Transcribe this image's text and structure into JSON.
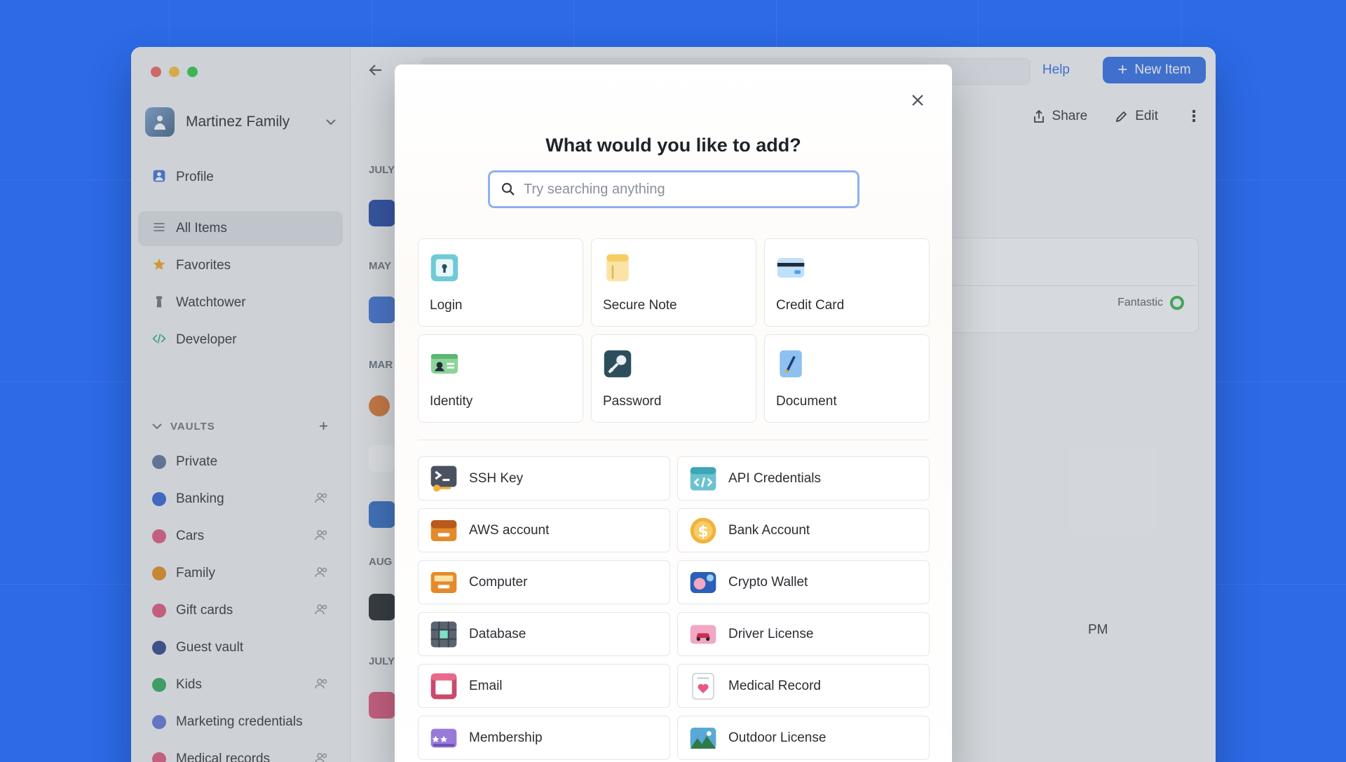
{
  "account": {
    "name": "Martinez Family"
  },
  "nav": [
    {
      "name": "nav-profile",
      "label": "Profile",
      "icon": "person-icon",
      "color": "#3a70d8",
      "active": false
    },
    {
      "name": "nav-all-items",
      "label": "All Items",
      "icon": "list-icon",
      "color": "#7a8088",
      "active": true
    },
    {
      "name": "nav-favorites",
      "label": "Favorites",
      "icon": "star-icon",
      "color": "#f2a413",
      "active": false
    },
    {
      "name": "nav-watchtower",
      "label": "Watchtower",
      "icon": "tower-icon",
      "color": "#6a6f77",
      "active": false
    },
    {
      "name": "nav-developer",
      "label": "Developer",
      "icon": "code-icon",
      "color": "#2aa87a",
      "active": false
    }
  ],
  "vaults": {
    "header": "VAULTS",
    "items": [
      {
        "label": "Private",
        "icon": "gear-icon",
        "color": "#5a6e9a",
        "shared": false
      },
      {
        "label": "Banking",
        "icon": "banking-icon",
        "color": "#2c5fd1",
        "shared": true
      },
      {
        "label": "Cars",
        "icon": "car-icon",
        "color": "#e0527a",
        "shared": true
      },
      {
        "label": "Family",
        "icon": "family-icon",
        "color": "#e28a15",
        "shared": true
      },
      {
        "label": "Gift cards",
        "icon": "gift-icon",
        "color": "#e0527a",
        "shared": true
      },
      {
        "label": "Guest vault",
        "icon": "guest-icon",
        "color": "#2c3f8a",
        "shared": false
      },
      {
        "label": "Kids",
        "icon": "kids-icon",
        "color": "#2aa857",
        "shared": true
      },
      {
        "label": "Marketing credentials",
        "icon": "marketing-icon",
        "color": "#5b6fd8",
        "shared": false
      },
      {
        "label": "Medical records",
        "icon": "medical-icon",
        "color": "#e0527a",
        "shared": true
      }
    ]
  },
  "toolbar": {
    "help": "Help",
    "new_item": "New Item"
  },
  "detail": {
    "share": "Share",
    "edit": "Edit",
    "strength": "Fantastic",
    "time_suffix": "PM"
  },
  "list": {
    "months": [
      "JULY",
      "MAY",
      "MAR",
      "AUG",
      "JULY"
    ]
  },
  "modal": {
    "title": "What would you like to add?",
    "search_placeholder": "Try searching anything",
    "tiles": [
      {
        "name": "tile-login",
        "label": "Login",
        "icon": "login-icon",
        "color": "#6fcad6"
      },
      {
        "name": "tile-secure-note",
        "label": "Secure Note",
        "icon": "note-icon",
        "color": "#f6cd62"
      },
      {
        "name": "tile-credit-card",
        "label": "Credit Card",
        "icon": "credit-card-icon",
        "color": "#4aa2ea"
      },
      {
        "name": "tile-identity",
        "label": "Identity",
        "icon": "identity-icon",
        "color": "#8ed49a"
      },
      {
        "name": "tile-password",
        "label": "Password",
        "icon": "key-icon",
        "color": "#2e4d5c"
      },
      {
        "name": "tile-document",
        "label": "Document",
        "icon": "document-icon",
        "color": "#8ec0f0"
      }
    ],
    "rows": [
      {
        "name": "row-ssh-key",
        "label": "SSH Key",
        "icon": "terminal-icon",
        "color": "#4a5260"
      },
      {
        "name": "row-api-credentials",
        "label": "API Credentials",
        "icon": "api-icon",
        "color": "#6cc2d0"
      },
      {
        "name": "row-aws-account",
        "label": "AWS account",
        "icon": "aws-icon",
        "color": "#e58a2c"
      },
      {
        "name": "row-bank-account",
        "label": "Bank Account",
        "icon": "coin-icon",
        "color": "#f2b23a"
      },
      {
        "name": "row-computer",
        "label": "Computer",
        "icon": "computer-icon",
        "color": "#e58a2c"
      },
      {
        "name": "row-crypto-wallet",
        "label": "Crypto Wallet",
        "icon": "wallet-icon",
        "color": "#2c5fb8"
      },
      {
        "name": "row-database",
        "label": "Database",
        "icon": "database-icon",
        "color": "#3c8c7a"
      },
      {
        "name": "row-driver-license",
        "label": "Driver License",
        "icon": "license-icon",
        "color": "#f2a7c2"
      },
      {
        "name": "row-email",
        "label": "Email",
        "icon": "email-icon",
        "color": "#c94a6a"
      },
      {
        "name": "row-medical-record",
        "label": "Medical Record",
        "icon": "medical-record-icon",
        "color": "#e55a80"
      },
      {
        "name": "row-membership",
        "label": "Membership",
        "icon": "membership-icon",
        "color": "#9a7ad8"
      },
      {
        "name": "row-outdoor-license",
        "label": "Outdoor License",
        "icon": "outdoor-icon",
        "color": "#5aa8d8"
      }
    ]
  }
}
